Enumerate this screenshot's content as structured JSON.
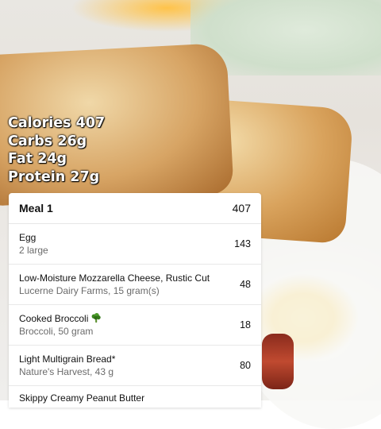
{
  "macros": {
    "calories": "Calories 407",
    "carbs": "Carbs 26g",
    "fat": "Fat 24g",
    "protein": "Protein 27g"
  },
  "meal": {
    "title": "Meal 1",
    "total": "407",
    "items": [
      {
        "name": "Egg",
        "detail": "2 large",
        "calories": "143"
      },
      {
        "name": "Low-Moisture Mozzarella Cheese, Rustic Cut",
        "detail": "Lucerne Dairy Farms, 15 gram(s)",
        "calories": "48"
      },
      {
        "name": "Cooked Broccoli",
        "icon": "broccoli-icon",
        "detail": "Broccoli, 50 gram",
        "calories": "18"
      },
      {
        "name": "Light Multigrain Bread*",
        "detail": "Nature's Harvest, 43 g",
        "calories": "80"
      },
      {
        "name": "Skippy Creamy Peanut Butter"
      }
    ]
  }
}
